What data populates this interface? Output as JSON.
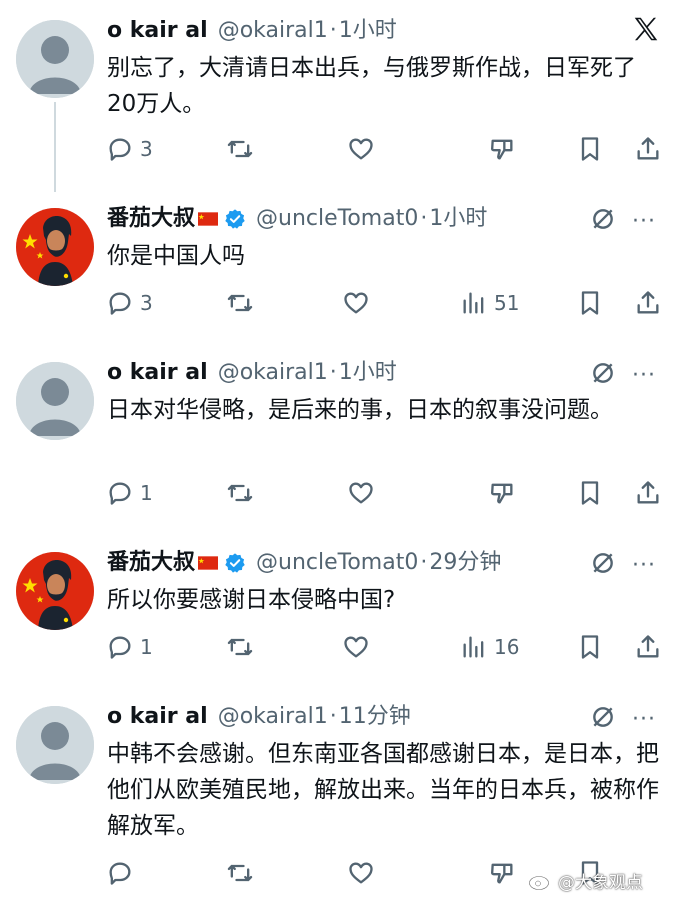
{
  "tweets": [
    {
      "name": "o kair al",
      "handle": "@okairal1",
      "separator": "·",
      "time": "1小时",
      "text": "别忘了，大清请日本出兵，与俄罗斯作战，日军死了20万人。",
      "replies": "3",
      "views": ""
    },
    {
      "name": "番茄大叔",
      "handle": "@uncleTomat0",
      "separator": "·",
      "time": "1小时",
      "text": "你是中国人吗",
      "replies": "3",
      "views": "51"
    },
    {
      "name": "o kair al",
      "handle": "@okairal1",
      "separator": "·",
      "time": "1小时",
      "text": "日本对华侵略，是后来的事，日本的叙事没问题。",
      "replies": "1",
      "views": ""
    },
    {
      "name": "番茄大叔",
      "handle": "@uncleTomat0",
      "separator": "·",
      "time": "29分钟",
      "text": "所以你要感谢日本侵略中国?",
      "replies": "1",
      "views": "16"
    },
    {
      "name": "o kair al",
      "handle": "@okairal1",
      "separator": "·",
      "time": "11分钟",
      "text": "中韩不会感谢。但东南亚各国都感谢日本，是日本，把他们从欧美殖民地，解放出来。当年的日本兵，被称作解放军。",
      "replies": "",
      "views": ""
    }
  ],
  "icons": [
    "reply-icon",
    "retweet-icon",
    "like-icon",
    "dislike-icon",
    "views-icon",
    "bookmark-icon",
    "share-icon",
    "grok-icon",
    "more-icon",
    "x-logo-icon",
    "verified-badge-icon",
    "china-flag-icon",
    "weibo-icon"
  ],
  "colors": {
    "text": "#0f1419",
    "secondary": "#536471",
    "verified": "#1d9bf0",
    "avatar_bg": "#cfd9de",
    "flag_red": "#de2910",
    "flag_star": "#ffde00"
  },
  "watermark": {
    "text": "@大象观点"
  }
}
